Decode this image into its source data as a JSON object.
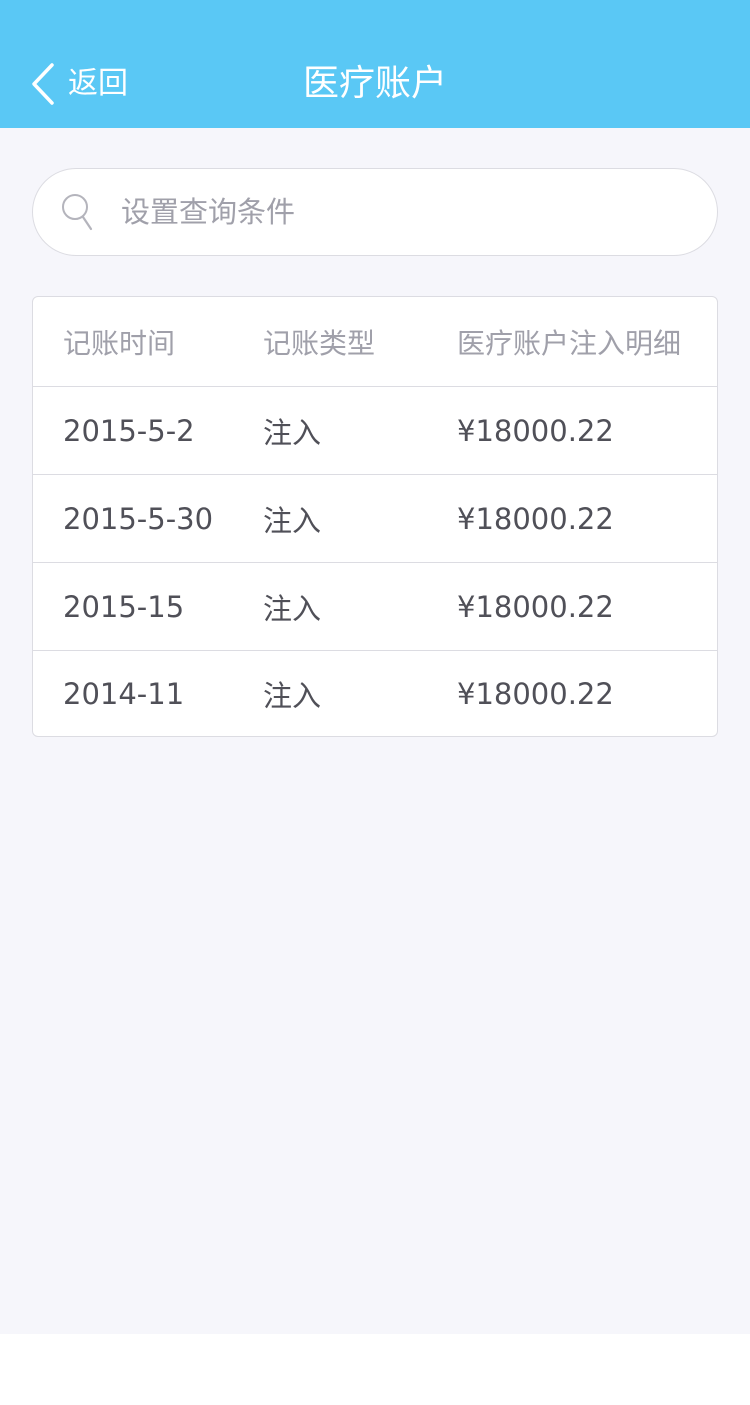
{
  "header": {
    "back_label": "返回",
    "title": "医疗账户",
    "background_color": "#5ac8f5"
  },
  "search": {
    "placeholder": "设置查询条件",
    "value": "",
    "icon": "search-icon"
  },
  "table": {
    "columns": [
      "记账时间",
      "记账类型",
      "医疗账户注入明细"
    ],
    "rows": [
      {
        "date": "2015-5-2",
        "type": "注入",
        "amount": "¥18000.22"
      },
      {
        "date": "2015-5-30",
        "type": "注入",
        "amount": "¥18000.22"
      },
      {
        "date": "2015-15",
        "type": "注入",
        "amount": "¥18000.22"
      },
      {
        "date": "2014-11",
        "type": "注入",
        "amount": "¥18000.22"
      }
    ]
  }
}
